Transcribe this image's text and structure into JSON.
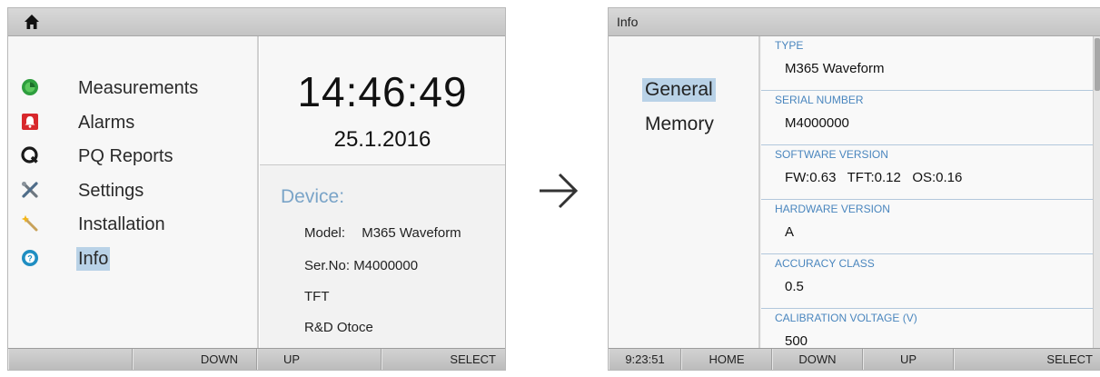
{
  "left_screen": {
    "icons": {
      "home": "home-icon"
    },
    "menu": [
      {
        "label": "Measurements",
        "icon": "measurements-icon",
        "selected": false
      },
      {
        "label": "Alarms",
        "icon": "alarm-bell-icon",
        "selected": false
      },
      {
        "label": "PQ Reports",
        "icon": "pq-reports-icon",
        "selected": false
      },
      {
        "label": "Settings",
        "icon": "settings-tools-icon",
        "selected": false
      },
      {
        "label": "Installation",
        "icon": "installation-wand-icon",
        "selected": false
      },
      {
        "label": "Info",
        "icon": "info-icon",
        "selected": true
      }
    ],
    "clock": {
      "time": "14:46:49",
      "date": "25.1.2016"
    },
    "device": {
      "heading": "Device:",
      "model_label": "Model:",
      "model_value": "M365 Waveform",
      "serial": "Ser.No: M4000000",
      "display": "TFT",
      "location": "R&D Otoce"
    },
    "softkeys": [
      "",
      "DOWN",
      "UP",
      "SELECT"
    ]
  },
  "arrow": {
    "icon": "right-arrow-icon"
  },
  "right_screen": {
    "title": "Info",
    "nav": [
      {
        "label": "General",
        "selected": true
      },
      {
        "label": "Memory",
        "selected": false
      }
    ],
    "fields": [
      {
        "label": "TYPE",
        "value": "M365  Waveform"
      },
      {
        "label": "SERIAL NUMBER",
        "value": "M4000000"
      },
      {
        "label": "SOFTWARE VERSION",
        "value": "FW:0.63   TFT:0.12   OS:0.16"
      },
      {
        "label": "HARDWARE VERSION",
        "value": "A"
      },
      {
        "label": "ACCURACY CLASS",
        "value": "0.5"
      },
      {
        "label": "CALIBRATION VOLTAGE (V)",
        "value": "500"
      }
    ],
    "status_time": "9:23:51",
    "softkeys": [
      "HOME",
      "DOWN",
      "UP",
      "SELECT"
    ]
  },
  "colors": {
    "selection": "#b9d2e7",
    "field_label": "#4a86be",
    "device_heading": "#7aa4c8",
    "measurements_icon": "#2e9e3e",
    "alarms_icon": "#d8282c",
    "info_icon": "#1f8ec2"
  }
}
